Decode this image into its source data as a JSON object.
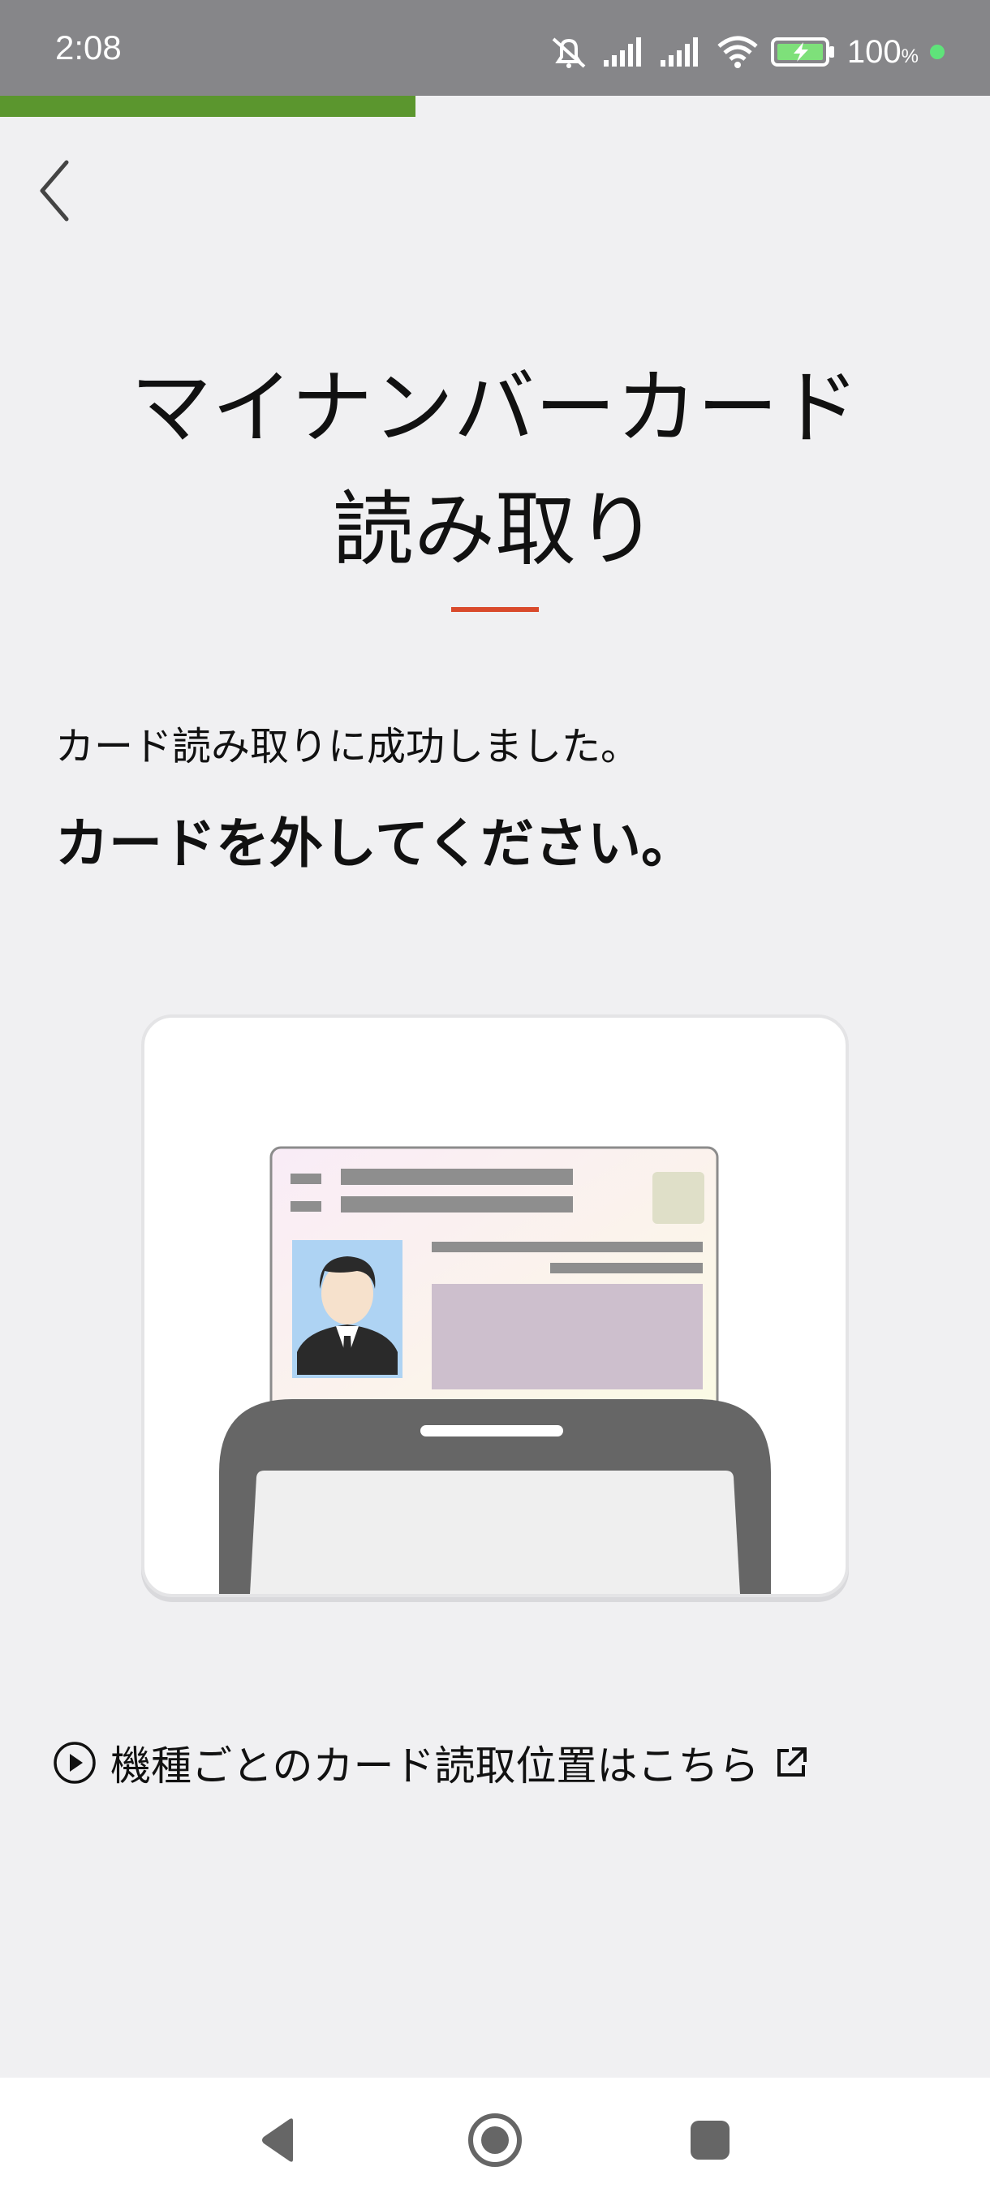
{
  "status_bar": {
    "time": "2:08",
    "battery_percent": "100",
    "battery_unit": "%",
    "icons": [
      "mute-icon",
      "signal-icon",
      "signal-icon",
      "wifi-icon",
      "battery-charging-icon",
      "green-dot"
    ]
  },
  "progress": {
    "value_fraction": 0.42,
    "color": "#5b962e"
  },
  "header": {
    "back_icon": "chevron-left-icon",
    "title_line1": "マイナンバーカード",
    "title_line2": "読み取り",
    "accent_color": "#d94a2c"
  },
  "main": {
    "success_message": "カード読み取りに成功しました。",
    "instruction": "カードを外してください。",
    "illustration": "id-card-in-phone-illustration",
    "help_link": {
      "label": "機種ごとのカード読取位置はこちら",
      "leading_icon": "play-circle-icon",
      "trailing_icon": "external-link-icon"
    }
  },
  "nav_bar": {
    "buttons": [
      "back-triangle-icon",
      "home-circle-icon",
      "recents-square-icon"
    ]
  }
}
